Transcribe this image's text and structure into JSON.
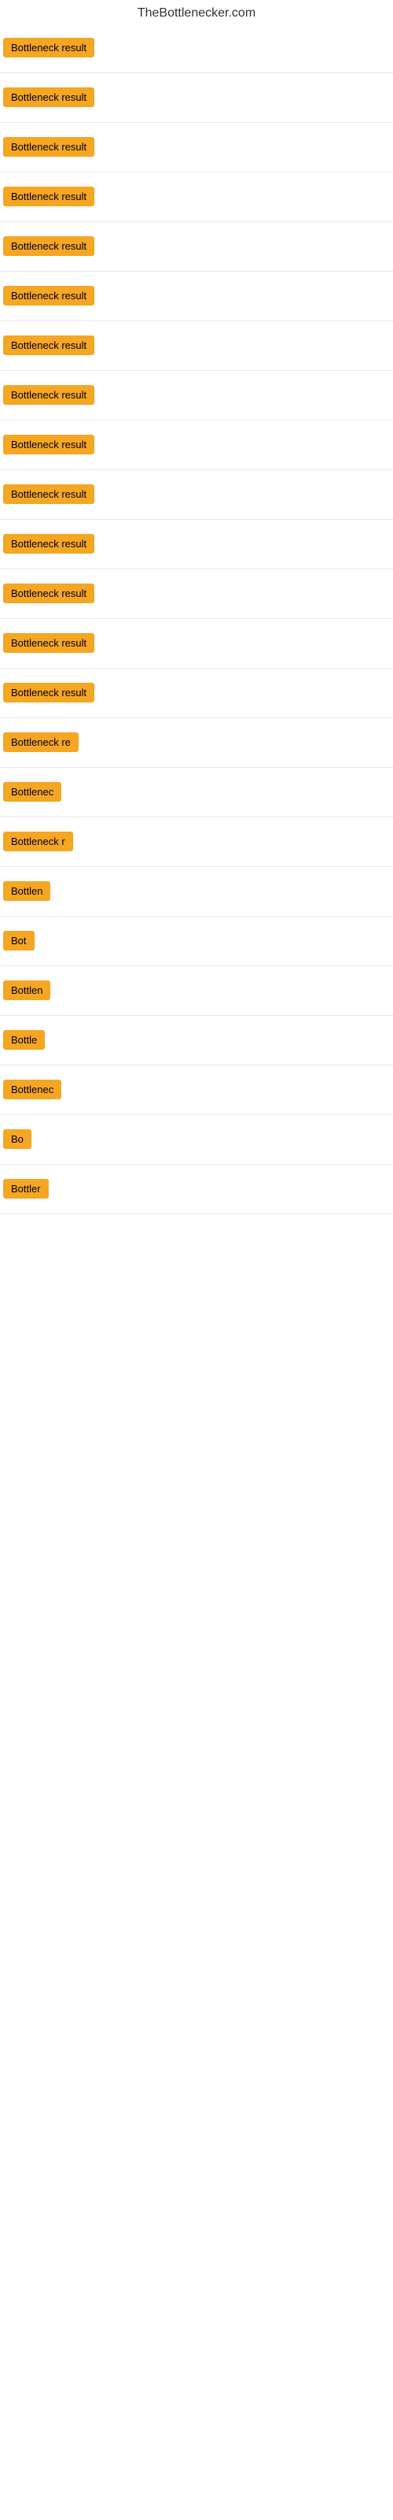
{
  "site": {
    "title": "TheBottlenecker.com"
  },
  "items": [
    {
      "id": 1,
      "label": "Bottleneck result",
      "truncated": false
    },
    {
      "id": 2,
      "label": "Bottleneck result",
      "truncated": false
    },
    {
      "id": 3,
      "label": "Bottleneck result",
      "truncated": false
    },
    {
      "id": 4,
      "label": "Bottleneck result",
      "truncated": false
    },
    {
      "id": 5,
      "label": "Bottleneck result",
      "truncated": false
    },
    {
      "id": 6,
      "label": "Bottleneck result",
      "truncated": false
    },
    {
      "id": 7,
      "label": "Bottleneck result",
      "truncated": false
    },
    {
      "id": 8,
      "label": "Bottleneck result",
      "truncated": false
    },
    {
      "id": 9,
      "label": "Bottleneck result",
      "truncated": false
    },
    {
      "id": 10,
      "label": "Bottleneck result",
      "truncated": false
    },
    {
      "id": 11,
      "label": "Bottleneck result",
      "truncated": false
    },
    {
      "id": 12,
      "label": "Bottleneck result",
      "truncated": false
    },
    {
      "id": 13,
      "label": "Bottleneck result",
      "truncated": false
    },
    {
      "id": 14,
      "label": "Bottleneck result",
      "truncated": false
    },
    {
      "id": 15,
      "label": "Bottleneck re",
      "truncated": true
    },
    {
      "id": 16,
      "label": "Bottlenec",
      "truncated": true
    },
    {
      "id": 17,
      "label": "Bottleneck r",
      "truncated": true
    },
    {
      "id": 18,
      "label": "Bottlen",
      "truncated": true
    },
    {
      "id": 19,
      "label": "Bot",
      "truncated": true
    },
    {
      "id": 20,
      "label": "Bottlen",
      "truncated": true
    },
    {
      "id": 21,
      "label": "Bottle",
      "truncated": true
    },
    {
      "id": 22,
      "label": "Bottlenec",
      "truncated": true
    },
    {
      "id": 23,
      "label": "Bo",
      "truncated": true
    },
    {
      "id": 24,
      "label": "Bottler",
      "truncated": true
    }
  ]
}
